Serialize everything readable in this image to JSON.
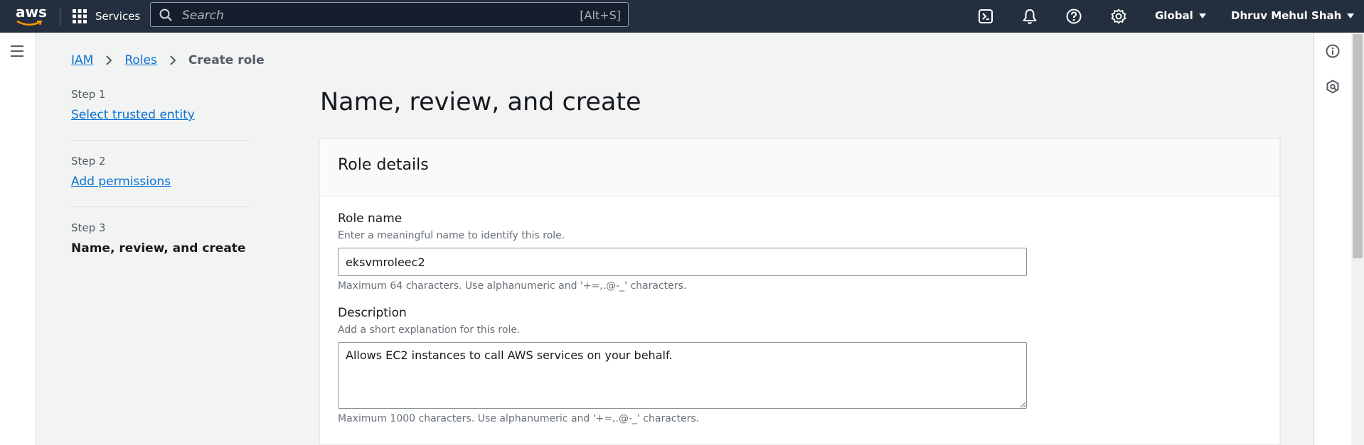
{
  "topbar": {
    "logo_text": "aws",
    "services_label": "Services",
    "search_placeholder": "Search",
    "search_shortcut": "[Alt+S]",
    "region_label": "Global",
    "account_label": "Dhruv Mehul Shah",
    "background_color": "#232f3e"
  },
  "breadcrumb": {
    "items": [
      {
        "label": "IAM"
      },
      {
        "label": "Roles"
      },
      {
        "label": "Create role"
      }
    ]
  },
  "steps": [
    {
      "number": "Step 1",
      "label": "Select trusted entity"
    },
    {
      "number": "Step 2",
      "label": "Add permissions"
    },
    {
      "number": "Step 3",
      "label": "Name, review, and create"
    }
  ],
  "page": {
    "title": "Name, review, and create"
  },
  "role_details": {
    "title": "Role details",
    "role_name": {
      "label": "Role name",
      "description": "Enter a meaningful name to identify this role.",
      "value": "eksvmroleec2",
      "constraint": "Maximum 64 characters. Use alphanumeric and '+=,.@-_' characters."
    },
    "description": {
      "label": "Description",
      "description": "Add a short explanation for this role.",
      "value": "Allows EC2 instances to call AWS services on your behalf.",
      "constraint": "Maximum 1000 characters. Use alphanumeric and '+=,.@-_' characters."
    }
  },
  "icons": {
    "topbar": [
      "cloudshell-icon",
      "notifications-icon",
      "help-icon",
      "settings-icon"
    ],
    "rail": [
      "info-icon",
      "feedback-icon"
    ]
  },
  "colors": {
    "link": "#0972d3",
    "page_background": "#f2f3f3"
  }
}
